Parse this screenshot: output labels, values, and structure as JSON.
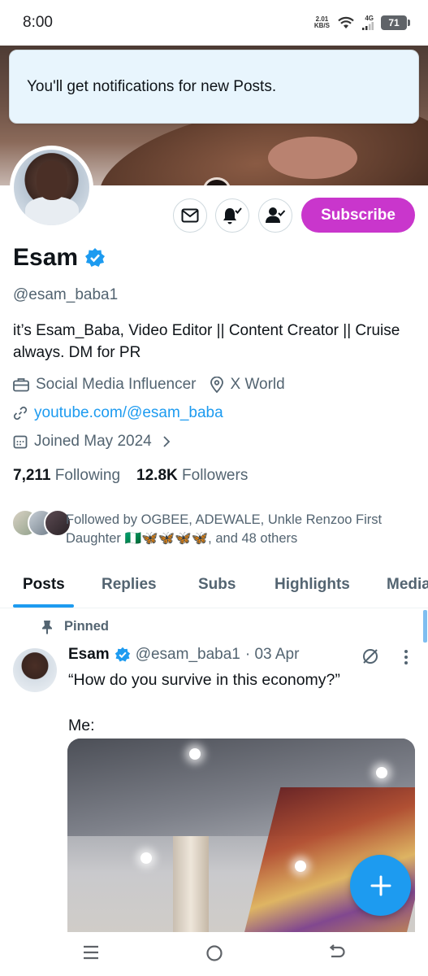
{
  "status_bar": {
    "time": "8:00",
    "net_speed_value": "2.01",
    "net_speed_unit": "KB/S",
    "network_type": "4G",
    "battery": "71"
  },
  "toast": {
    "message": "You'll get notifications for new Posts."
  },
  "actions": {
    "subscribe_label": "Subscribe"
  },
  "profile": {
    "display_name": "Esam",
    "handle": "@esam_baba1",
    "bio": "it’s Esam_Baba, Video Editor  || Content Creator || Cruise always. DM for PR",
    "category": "Social Media Influencer",
    "location": "X World",
    "website": "youtube.com/@esam_baba",
    "joined": "Joined May 2024",
    "following_count": "7,211",
    "following_label": "Following",
    "followers_count": "12.8K",
    "followers_label": "Followers",
    "followed_by": "Followed by OGBEE, ADEWALE, Unkle Renzoo First Daughter 🇳🇬🦋🦋🦋🦋, and 48 others"
  },
  "tabs": [
    "Posts",
    "Replies",
    "Subs",
    "Highlights",
    "Media"
  ],
  "post": {
    "pinned_label": "Pinned",
    "author_name": "Esam",
    "author_handle": "@esam_baba1",
    "date": "· 03 Apr",
    "text": "“How do you survive in this economy?”\n\nMe:"
  },
  "colors": {
    "accent": "#1d9bf0",
    "subscribe": "#c936cc",
    "secondary_text": "#536471"
  }
}
